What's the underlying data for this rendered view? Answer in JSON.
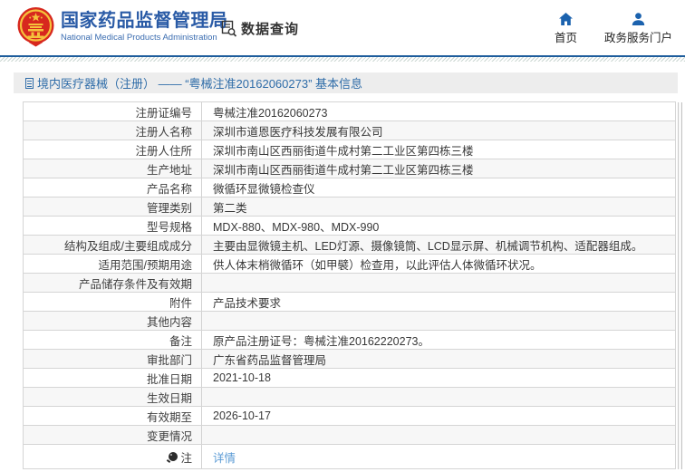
{
  "header": {
    "title": "国家药品监督管理局",
    "subtitle": "National Medical Products Administration",
    "data_query": {
      "label": "数据查询",
      "icon": "document-search-icon"
    },
    "nav": [
      {
        "label": "首页",
        "icon": "home-icon"
      },
      {
        "label": "政务服务门户",
        "icon": "user-icon"
      }
    ]
  },
  "breadcrumb": {
    "icon": "page-icon",
    "text": "境内医疗器械（注册） —— “粤械注准20162060273” 基本信息"
  },
  "table": {
    "rows": [
      {
        "label": "注册证编号",
        "value": "粤械注准20162060273"
      },
      {
        "label": "注册人名称",
        "value": "深圳市道恩医疗科技发展有限公司"
      },
      {
        "label": "注册人住所",
        "value": "深圳市南山区西丽街道牛成村第二工业区第四栋三楼"
      },
      {
        "label": "生产地址",
        "value": "深圳市南山区西丽街道牛成村第二工业区第四栋三楼"
      },
      {
        "label": "产品名称",
        "value": "微循环显微镜检查仪"
      },
      {
        "label": "管理类别",
        "value": "第二类"
      },
      {
        "label": "型号规格",
        "value": "MDX-880、MDX-980、MDX-990"
      },
      {
        "label": "结构及组成/主要组成成分",
        "value": "主要由显微镜主机、LED灯源、摄像镜筒、LCD显示屏、机械调节机构、适配器组成。"
      },
      {
        "label": "适用范围/预期用途",
        "value": "供人体末梢微循环（如甲襞）检查用，以此评估人体微循环状况。"
      },
      {
        "label": "产品储存条件及有效期",
        "value": ""
      },
      {
        "label": "附件",
        "value": "产品技术要求"
      },
      {
        "label": "其他内容",
        "value": ""
      },
      {
        "label": "备注",
        "value": "原产品注册证号：粤械注准20162220273。"
      },
      {
        "label": "审批部门",
        "value": "广东省药品监督管理局"
      },
      {
        "label": "批准日期",
        "value": "2021-10-18"
      },
      {
        "label": "生效日期",
        "value": ""
      },
      {
        "label": "有效期至",
        "value": "2026-10-17"
      },
      {
        "label": "变更情况",
        "value": ""
      },
      {
        "label": "注",
        "value": "详情",
        "icon": "note-icon",
        "value_is_link": true
      }
    ]
  },
  "colors": {
    "brand_blue": "#2a5ba6",
    "nav_icon_blue": "#1b62ae",
    "divider_blue": "#1e5d9c",
    "breadcrumb_text_blue": "#2e6ca8",
    "link_blue": "#5b9bd5",
    "zebra_gray": "#f7f7f7",
    "border_gray": "#d5d5d5",
    "emblem_red": "#d7281e",
    "emblem_gold": "#f5c23c"
  }
}
